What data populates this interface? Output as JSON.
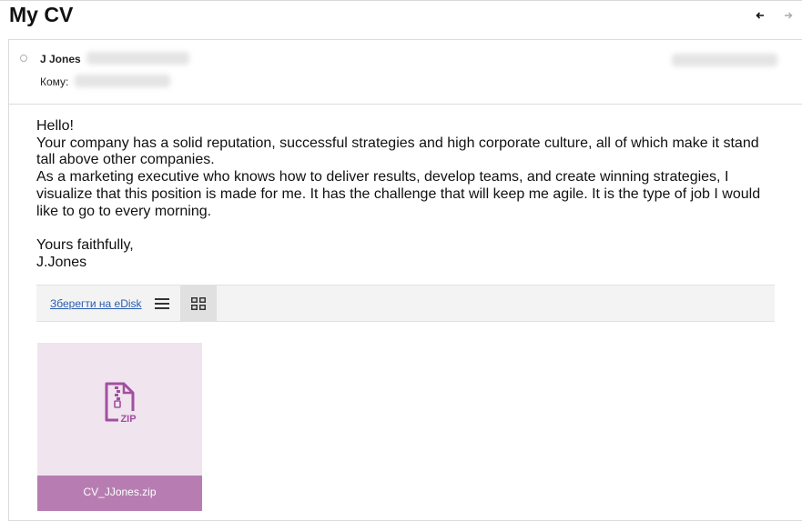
{
  "message": {
    "subject": "My CV",
    "sender_name": "J Jones",
    "to_label": "Кому:",
    "body": {
      "greeting": "Hello!",
      "paragraph1": "Your company has a solid reputation, successful strategies and high corporate culture, all of which make it stand tall above other companies.",
      "paragraph2": "As a marketing executive who knows how to deliver results, develop teams, and create winning strategies, I visualize that this position is made for me. It has the challenge that will keep me agile. It is the type of job I would like to go to every morning.",
      "closing": "Yours faithfully,",
      "signature": "J.Jones"
    }
  },
  "attachments": {
    "save_link": "Зберегти на eDisk",
    "files": [
      {
        "name": "CV_JJones.zip",
        "type_label": "ZIP"
      }
    ]
  },
  "colors": {
    "accent": "#b77db2",
    "tile_bg": "#f0e4ee",
    "link": "#2a5db0"
  },
  "icons": {
    "prev": "arrow-left-icon",
    "next": "arrow-right-icon",
    "list_view": "list-view-icon",
    "grid_view": "grid-view-icon",
    "file": "zip-file-icon"
  }
}
